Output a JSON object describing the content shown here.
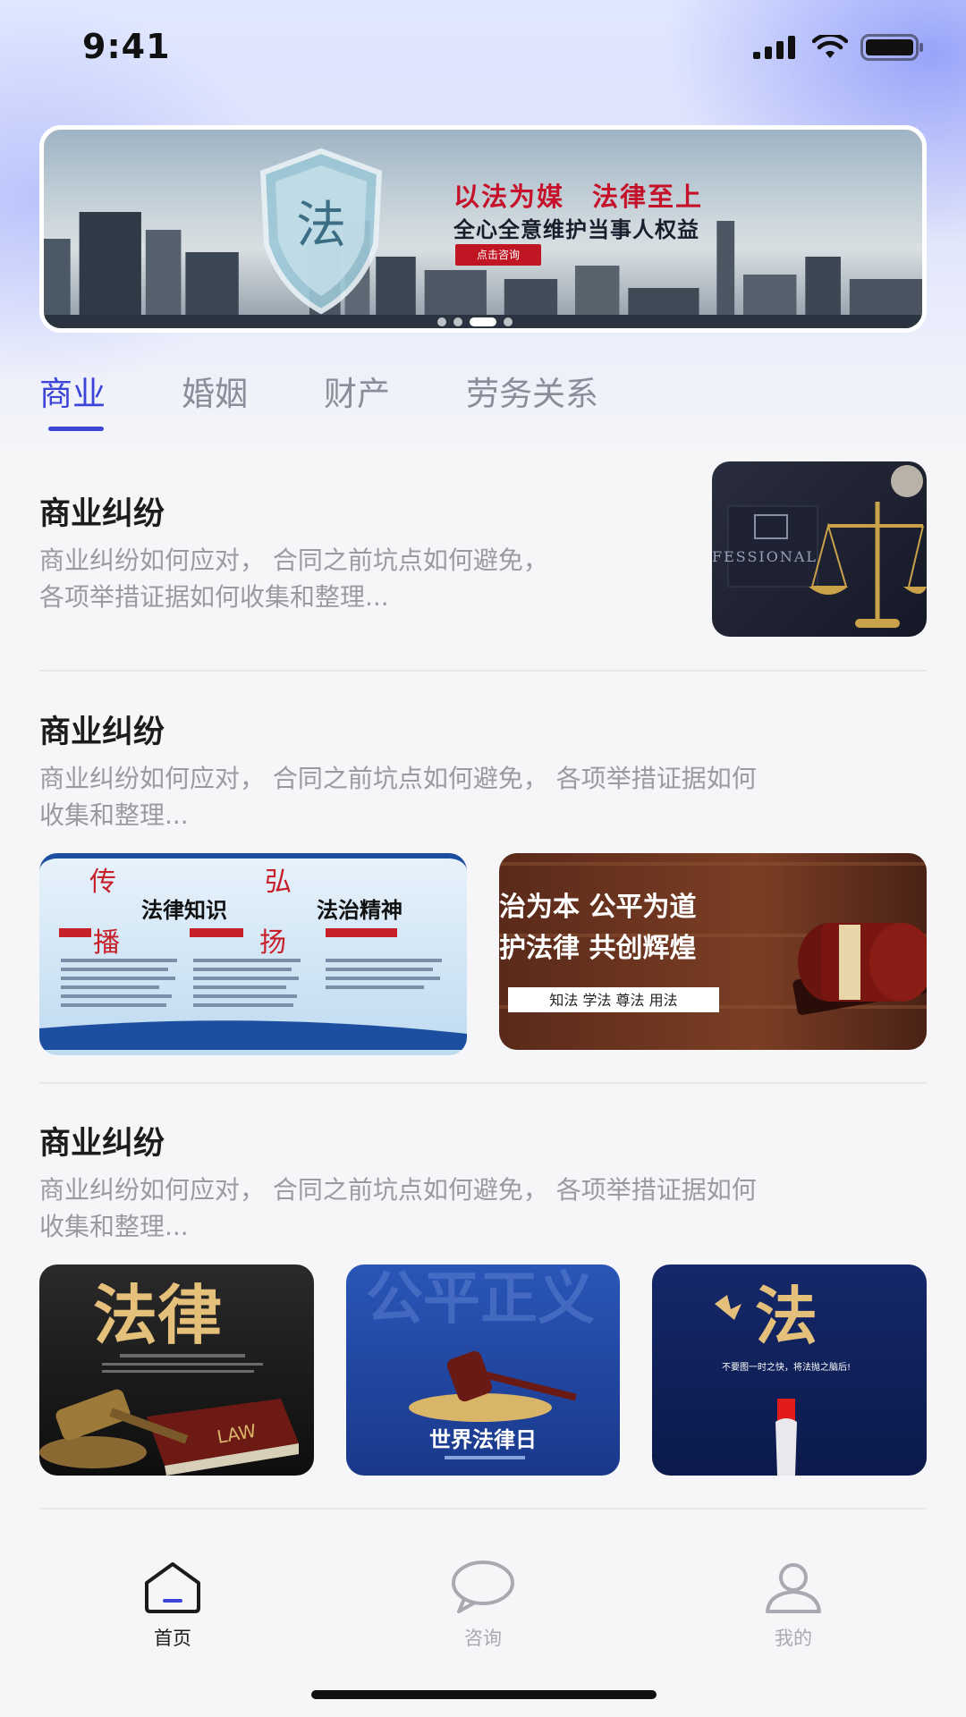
{
  "status": {
    "time": "9:41"
  },
  "banner": {
    "headline": "以法为媒　法律至上",
    "subline": "全心全意维护当事人权益",
    "button": "点击咨询",
    "shield_char": "法"
  },
  "tabs": [
    {
      "label": "商业"
    },
    {
      "label": "婚姻"
    },
    {
      "label": "财产"
    },
    {
      "label": "劳务关系"
    }
  ],
  "articles": [
    {
      "title": "商业纠纷",
      "desc_lines": [
        "商业纠纷如何应对， 合同之前坑点如何避免，",
        "各项举措证据如何收集和整理..."
      ],
      "image_text": "FESSIONAL"
    },
    {
      "title": "商业纠纷",
      "desc_lines": [
        "商业纠纷如何应对， 合同之前坑点如何避免， 各项举措证据如何",
        "收集和整理..."
      ],
      "images": [
        {
          "title_a": "法律知识",
          "title_b": "法治精神",
          "chars": [
            "传",
            "弘",
            "播",
            "扬"
          ]
        },
        {
          "line1": "治为本 公平为道",
          "line2": "护法律 共创辉煌",
          "tag": "知法 学法 尊法 用法"
        }
      ]
    },
    {
      "title": "商业纠纷",
      "desc_lines": [
        "商业纠纷如何应对， 合同之前坑点如何避免， 各项举措证据如何",
        "收集和整理..."
      ],
      "images": [
        {
          "big": "法律",
          "book": "LAW"
        },
        {
          "caption": "世界法律日",
          "bg_text": "公平正义"
        },
        {
          "big": "法",
          "note": "不要图一时之快，将法抛之脑后!"
        }
      ]
    }
  ],
  "tabbar": [
    {
      "label": "首页",
      "icon": "home-icon",
      "active": true
    },
    {
      "label": "咨询",
      "icon": "chat-icon",
      "active": false
    },
    {
      "label": "我的",
      "icon": "user-icon",
      "active": false
    }
  ],
  "colors": {
    "accent": "#3c45d8",
    "inactive": "#8c8c9a",
    "background": "#f6f6f8"
  }
}
